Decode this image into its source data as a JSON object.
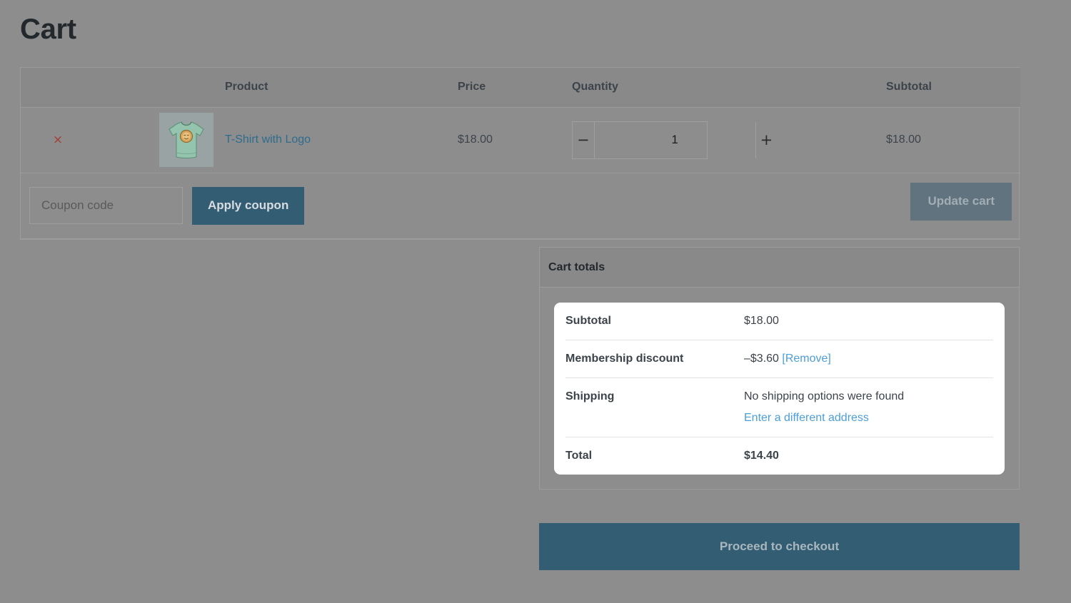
{
  "page": {
    "title": "Cart"
  },
  "cart_table": {
    "headers": {
      "remove": "",
      "thumbnail": "",
      "product": "Product",
      "price": "Price",
      "quantity": "Quantity",
      "subtotal": "Subtotal"
    },
    "items": [
      {
        "remove_icon": "close-x-icon",
        "remove_label": "×",
        "thumbnail_alt": "tshirt-thumbnail",
        "name": "T-Shirt with Logo",
        "price": "$18.00",
        "quantity": "1",
        "decrease_label": "−",
        "increase_label": "+",
        "subtotal": "$18.00"
      }
    ],
    "coupon": {
      "placeholder": "Coupon code",
      "value": "",
      "apply_label": "Apply coupon"
    },
    "update_cart_label": "Update cart"
  },
  "cart_totals": {
    "heading": "Cart totals",
    "rows": [
      {
        "label": "Subtotal",
        "value": "$18.00",
        "bold_value": false
      },
      {
        "label": "Membership discount",
        "value": "–$3.60",
        "link": "[Remove]",
        "bold_value": false
      },
      {
        "label": "Shipping",
        "value": "No shipping options were found",
        "link": "Enter a different address",
        "bold_value": false
      },
      {
        "label": "Total",
        "value": "$14.40",
        "bold_value": true
      }
    ]
  },
  "checkout": {
    "label": "Proceed to checkout"
  },
  "colors": {
    "page_background": "#8d8d8d",
    "table_header_background": "#898989",
    "border": "#9c9c9c",
    "primary_button": "#335d72",
    "disabled_button": "#61737f",
    "link": "#2e6c8e",
    "accent_link": "#4c9ed9",
    "remove_icon": "#a33c32",
    "card_background": "#ffffff",
    "thumbnail_background": "#9aa3a4"
  }
}
